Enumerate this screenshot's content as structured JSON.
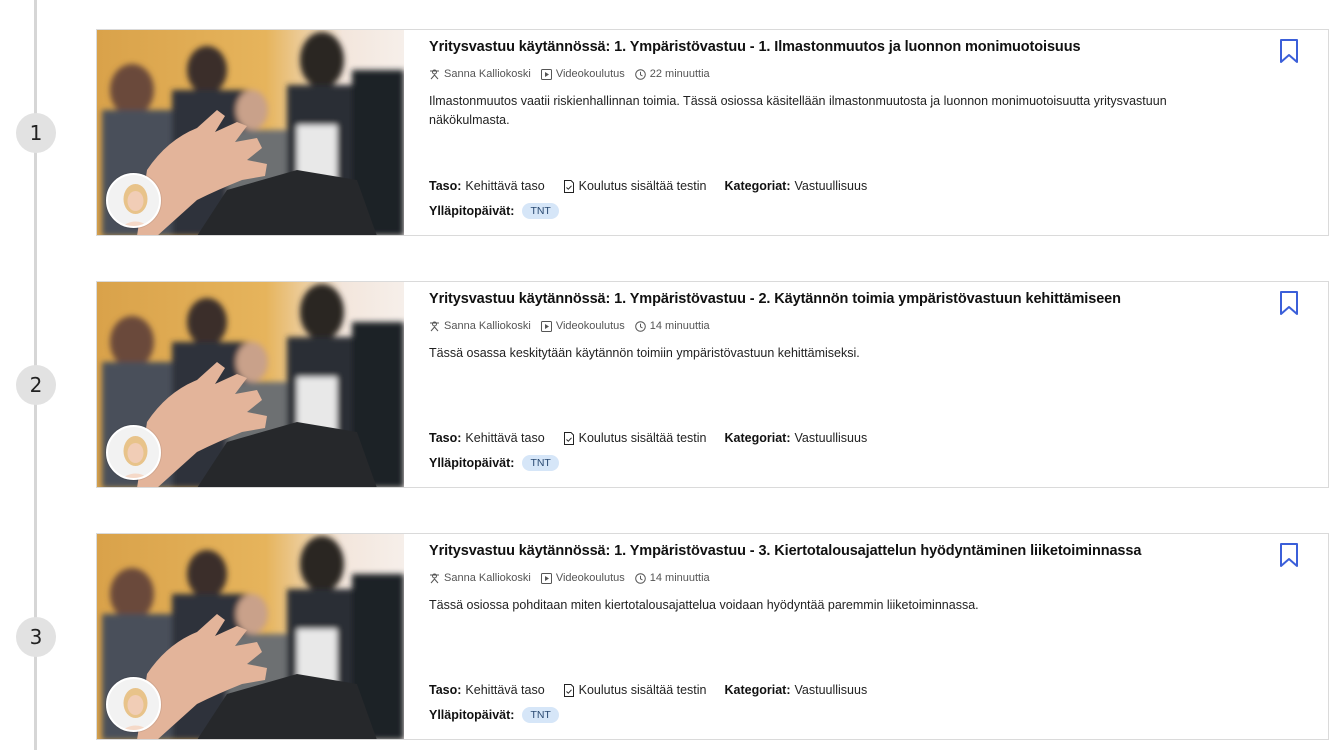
{
  "accent_color": "#3b5fd9",
  "courses": [
    {
      "step": "1",
      "title": "Yritysvastuu käytännössä: 1. Ympäristövastuu - 1. Ilmastonmuutos ja luonnon monimuotoisuus",
      "author": "Sanna Kalliokoski",
      "type": "Videokoulutus",
      "duration": "22 minuuttia",
      "description": "Ilmastonmuutos vaatii riskienhallinnan toimia. Tässä osiossa käsitellään ilmastonmuutosta ja luonnon monimuotoisuutta yritysvastuun näkökulmasta.",
      "level_label": "Taso:",
      "level_value": "Kehittävä taso",
      "test_label": "Koulutus sisältää testin",
      "category_label": "Kategoriat:",
      "category_value": "Vastuullisuus",
      "maintenance_label": "Ylläpitopäivät:",
      "maintenance_badge": "TNT"
    },
    {
      "step": "2",
      "title": "Yritysvastuu käytännössä: 1. Ympäristövastuu - 2. Käytännön toimia ympäristövastuun kehittämiseen",
      "author": "Sanna Kalliokoski",
      "type": "Videokoulutus",
      "duration": "14 minuuttia",
      "description": "Tässä osassa keskitytään käytännön toimiin ympäristövastuun kehittämiseksi.",
      "level_label": "Taso:",
      "level_value": "Kehittävä taso",
      "test_label": "Koulutus sisältää testin",
      "category_label": "Kategoriat:",
      "category_value": "Vastuullisuus",
      "maintenance_label": "Ylläpitopäivät:",
      "maintenance_badge": "TNT"
    },
    {
      "step": "3",
      "title": "Yritysvastuu käytännössä: 1. Ympäristövastuu - 3. Kiertotalousajattelun hyödyntäminen liiketoiminnassa",
      "author": "Sanna Kalliokoski",
      "type": "Videokoulutus",
      "duration": "14 minuuttia",
      "description": "Tässä osiossa pohditaan miten kiertotalousajattelua voidaan hyödyntää paremmin liiketoiminnassa.",
      "level_label": "Taso:",
      "level_value": "Kehittävä taso",
      "test_label": "Koulutus sisältää testin",
      "category_label": "Kategoriat:",
      "category_value": "Vastuullisuus",
      "maintenance_label": "Ylläpitopäivät:",
      "maintenance_badge": "TNT"
    }
  ]
}
